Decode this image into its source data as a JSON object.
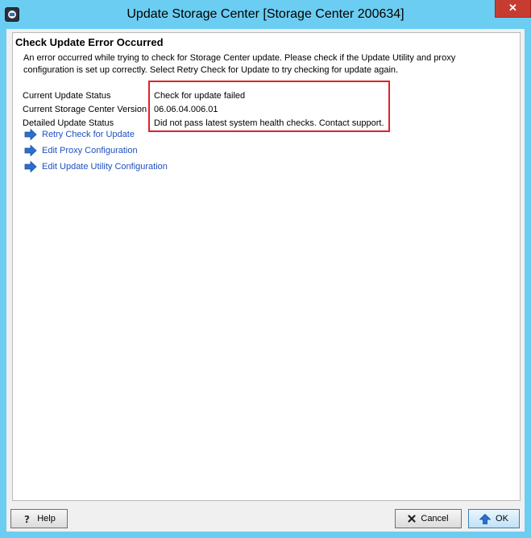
{
  "window": {
    "title": "Update Storage Center [Storage Center 200634]",
    "close_glyph": "✕"
  },
  "dialog": {
    "heading": "Check Update Error Occurred",
    "description": "An error occurred while trying to check for Storage Center update. Please check if the Update Utility and proxy configuration is set up correctly. Select Retry Check for Update to try checking for update again.",
    "status_rows": [
      {
        "label": "Current Update Status",
        "value": "Check for update failed"
      },
      {
        "label": "Current Storage Center Version",
        "value": "06.06.04.006.01"
      },
      {
        "label": "Detailed Update Status",
        "value": "Did not pass latest system health checks. Contact support."
      }
    ],
    "links": [
      {
        "label": "Retry Check for Update",
        "icon": "arrow-right-icon"
      },
      {
        "label": "Edit Proxy Configuration",
        "icon": "arrow-right-icon"
      },
      {
        "label": "Edit Update Utility Configuration",
        "icon": "arrow-right-icon"
      }
    ],
    "highlight_color": "#e3202a",
    "link_color": "#1f4fbf"
  },
  "footer": {
    "help_label": "Help",
    "cancel_label": "Cancel",
    "ok_label": "OK"
  }
}
